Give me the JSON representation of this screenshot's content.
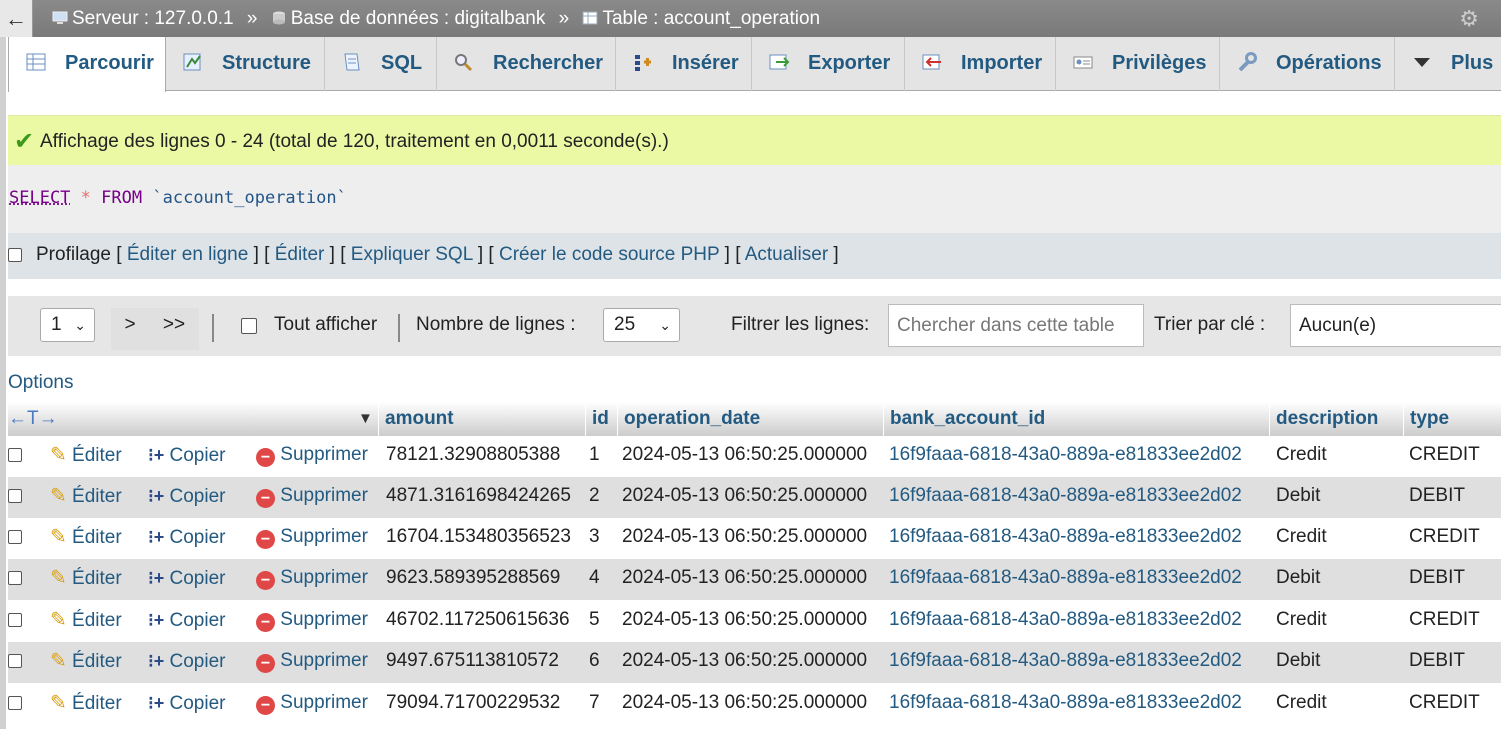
{
  "breadcrumb": {
    "server": "Serveur : 127.0.0.1",
    "database": "Base de données : digitalbank",
    "table": "Table : account_operation",
    "separator": "»"
  },
  "tabs": [
    {
      "label": "Parcourir",
      "icon": "browse-icon",
      "active": true
    },
    {
      "label": "Structure",
      "icon": "structure-icon"
    },
    {
      "label": "SQL",
      "icon": "sql-icon"
    },
    {
      "label": "Rechercher",
      "icon": "search-icon"
    },
    {
      "label": "Insérer",
      "icon": "insert-icon"
    },
    {
      "label": "Exporter",
      "icon": "export-icon"
    },
    {
      "label": "Importer",
      "icon": "import-icon"
    },
    {
      "label": "Privilèges",
      "icon": "privileges-icon"
    },
    {
      "label": "Opérations",
      "icon": "operations-icon"
    },
    {
      "label": "Plus",
      "icon": "caret-down-icon"
    }
  ],
  "success_message": "Affichage des lignes 0 - 24 (total de 120, traitement en 0,0011 seconde(s).)",
  "sql": {
    "select": "SELECT",
    "star": "*",
    "from": "FROM",
    "table": "`account_operation`"
  },
  "query_links": {
    "profiling": "Profilage",
    "edit_inline": "Éditer en ligne",
    "edit": "Éditer",
    "explain": "Expliquer SQL",
    "php_code": "Créer le code source PHP",
    "refresh": "Actualiser"
  },
  "navigation": {
    "page": "1",
    "next": ">",
    "last": ">>",
    "show_all": "Tout afficher",
    "rows_label": "Nombre de lignes :",
    "rows_value": "25",
    "filter_label": "Filtrer les lignes:",
    "filter_placeholder": "Chercher dans cette table",
    "sort_label": "Trier par clé :",
    "sort_value": "Aucun(e)"
  },
  "options_label": "Options",
  "columns": [
    "amount",
    "id",
    "operation_date",
    "bank_account_id",
    "description",
    "type"
  ],
  "actions": {
    "edit": "Éditer",
    "copy": "Copier",
    "delete": "Supprimer"
  },
  "rows": [
    {
      "amount": "78121.32908805388",
      "id": "1",
      "operation_date": "2024-05-13 06:50:25.000000",
      "bank_account_id": "16f9faaa-6818-43a0-889a-e81833ee2d02",
      "description": "Credit",
      "type": "CREDIT"
    },
    {
      "amount": "4871.3161698424265",
      "id": "2",
      "operation_date": "2024-05-13 06:50:25.000000",
      "bank_account_id": "16f9faaa-6818-43a0-889a-e81833ee2d02",
      "description": "Debit",
      "type": "DEBIT"
    },
    {
      "amount": "16704.153480356523",
      "id": "3",
      "operation_date": "2024-05-13 06:50:25.000000",
      "bank_account_id": "16f9faaa-6818-43a0-889a-e81833ee2d02",
      "description": "Credit",
      "type": "CREDIT"
    },
    {
      "amount": "9623.589395288569",
      "id": "4",
      "operation_date": "2024-05-13 06:50:25.000000",
      "bank_account_id": "16f9faaa-6818-43a0-889a-e81833ee2d02",
      "description": "Debit",
      "type": "DEBIT"
    },
    {
      "amount": "46702.117250615636",
      "id": "5",
      "operation_date": "2024-05-13 06:50:25.000000",
      "bank_account_id": "16f9faaa-6818-43a0-889a-e81833ee2d02",
      "description": "Credit",
      "type": "CREDIT"
    },
    {
      "amount": "9497.675113810572",
      "id": "6",
      "operation_date": "2024-05-13 06:50:25.000000",
      "bank_account_id": "16f9faaa-6818-43a0-889a-e81833ee2d02",
      "description": "Debit",
      "type": "DEBIT"
    },
    {
      "amount": "79094.71700229532",
      "id": "7",
      "operation_date": "2024-05-13 06:50:25.000000",
      "bank_account_id": "16f9faaa-6818-43a0-889a-e81833ee2d02",
      "description": "Credit",
      "type": "CREDIT"
    }
  ]
}
